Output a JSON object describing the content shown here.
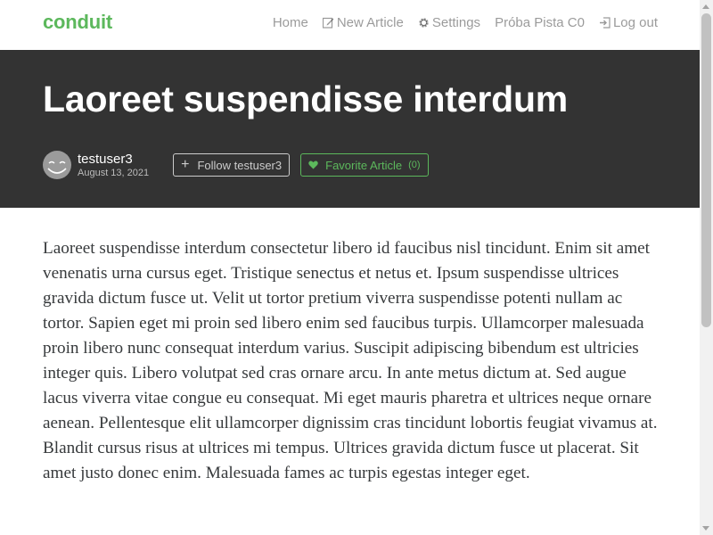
{
  "nav": {
    "brand": "conduit",
    "links": [
      {
        "label": "Home",
        "icon": ""
      },
      {
        "label": "New Article",
        "icon": "edit-icon"
      },
      {
        "label": "Settings",
        "icon": "gear-icon"
      },
      {
        "label": "Próba Pista C0",
        "icon": ""
      },
      {
        "label": "Log out",
        "icon": "logout-icon"
      }
    ]
  },
  "article": {
    "title": "Laoreet suspendisse interdum",
    "author": "testuser3",
    "date": "August 13, 2021",
    "follow_label": "Follow testuser3",
    "favorite_label": "Favorite Article",
    "favorite_count": "(0)",
    "body": "Laoreet suspendisse interdum consectetur libero id faucibus nisl tincidunt. Enim sit amet venenatis urna cursus eget. Tristique senectus et netus et. Ipsum suspendisse ultrices gravida dictum fusce ut. Velit ut tortor pretium viverra suspendisse potenti nullam ac tortor. Sapien eget mi proin sed libero enim sed faucibus turpis. Ullamcorper malesuada proin libero nunc consequat interdum varius. Suscipit adipiscing bibendum est ultricies integer quis. Libero volutpat sed cras ornare arcu. In ante metus dictum at. Sed augue lacus viverra vitae congue eu consequat. Mi eget mauris pharetra et ultrices neque ornare aenean. Pellentesque elit ullamcorper dignissim cras tincidunt lobortis feugiat vivamus at. Blandit cursus risus at ultrices mi tempus. Ultrices gravida dictum fusce ut placerat. Sit amet justo donec enim. Malesuada fames ac turpis egestas integer eget."
  },
  "colors": {
    "brand": "#5cb85c",
    "banner": "#333333",
    "text": "#373a3c"
  }
}
